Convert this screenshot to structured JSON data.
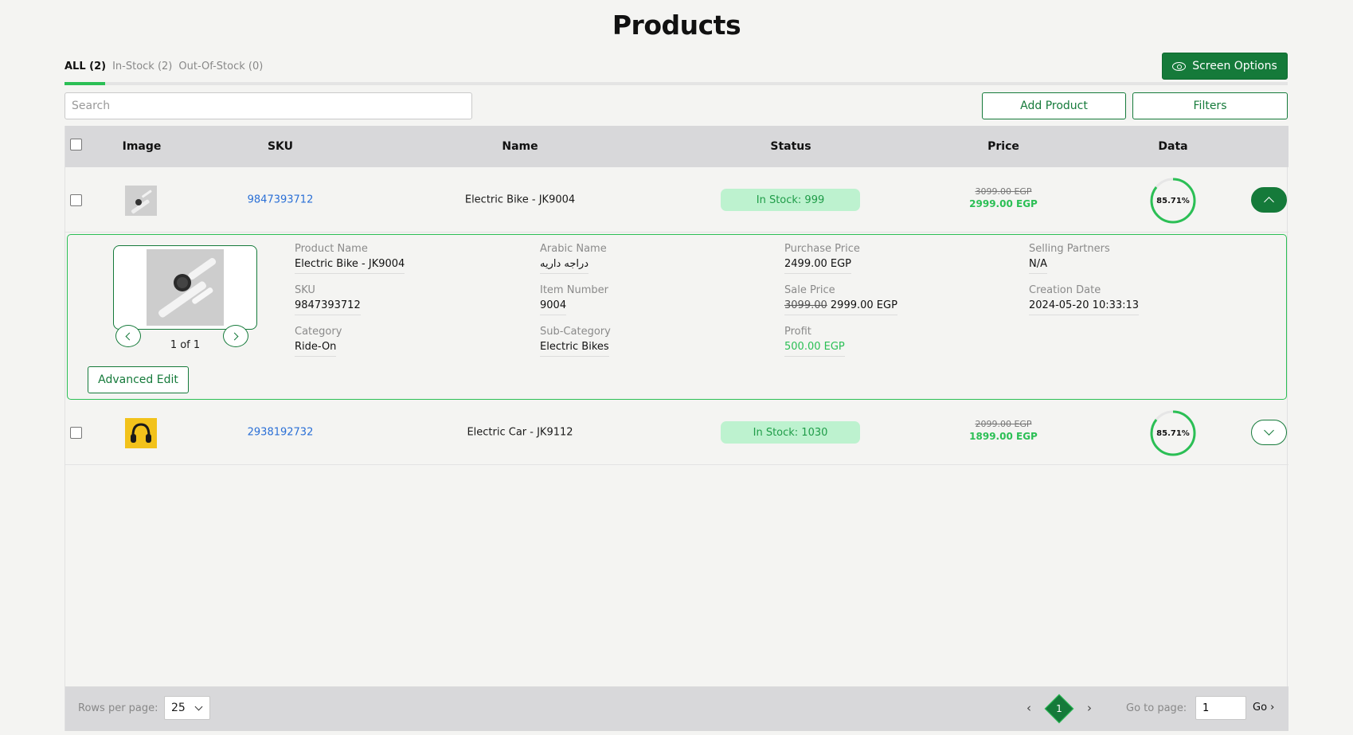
{
  "page": {
    "title": "Products"
  },
  "tabs": [
    {
      "label": "ALL (2)",
      "active": true
    },
    {
      "label": "In-Stock (2)",
      "active": false
    },
    {
      "label": "Out-Of-Stock (0)",
      "active": false
    }
  ],
  "toolbar": {
    "screen_options_label": "Screen Options",
    "screen_options_icon": "eye-icon",
    "search_placeholder": "Search",
    "add_product_label": "Add Product",
    "filters_label": "Filters"
  },
  "table": {
    "headers": [
      "Image",
      "SKU",
      "Name",
      "Status",
      "Price",
      "Data"
    ],
    "rows": [
      {
        "sku": "9847393712",
        "name": "Electric Bike - JK9004",
        "status": "In Stock: 999",
        "price_old": "3099.00 EGP",
        "price_new": "2999.00 EGP",
        "data_percent": "85.71%",
        "data_value": 0.8571,
        "expanded": true,
        "image_icon": "watch-thumbnail"
      },
      {
        "sku": "2938192732",
        "name": "Electric Car - JK9112",
        "status": "In Stock: 1030",
        "price_old": "2099.00 EGP",
        "price_new": "1899.00 EGP",
        "data_percent": "85.71%",
        "data_value": 0.8571,
        "expanded": false,
        "image_icon": "headphones-thumbnail"
      }
    ]
  },
  "detail": {
    "image_counter": "1 of 1",
    "advanced_edit_label": "Advanced Edit",
    "product_name": {
      "label": "Product Name",
      "value": "Electric Bike - JK9004"
    },
    "sku": {
      "label": "SKU",
      "value": "9847393712"
    },
    "category": {
      "label": "Category",
      "value": "Ride-On"
    },
    "arabic_name": {
      "label": "Arabic Name",
      "value": "دراجه داريه"
    },
    "item_number": {
      "label": "Item Number",
      "value": "9004"
    },
    "sub_category": {
      "label": "Sub-Category",
      "value": "Electric Bikes"
    },
    "purchase_price": {
      "label": "Purchase Price",
      "value": "2499.00 EGP"
    },
    "sale_price": {
      "label": "Sale Price",
      "old": "3099.00",
      "new": "2999.00 EGP"
    },
    "profit": {
      "label": "Profit",
      "value": "500.00 EGP"
    },
    "selling_partners": {
      "label": "Selling Partners",
      "value": "N/A"
    },
    "creation_date": {
      "label": "Creation Date",
      "value": "2024-05-20 10:33:13"
    }
  },
  "footer": {
    "rows_per_page_label": "Rows per page:",
    "rows_per_page_value": "25",
    "current_page": "1",
    "prev_symbol": "‹",
    "next_symbol": "›",
    "goto_label": "Go to page:",
    "goto_value": "1",
    "go_label": "Go ›"
  },
  "colors": {
    "brand_green": "#157a3a",
    "accent_green": "#2bbf55",
    "link_blue": "#2a6fd6",
    "pill_bg": "#bdf2cf"
  }
}
